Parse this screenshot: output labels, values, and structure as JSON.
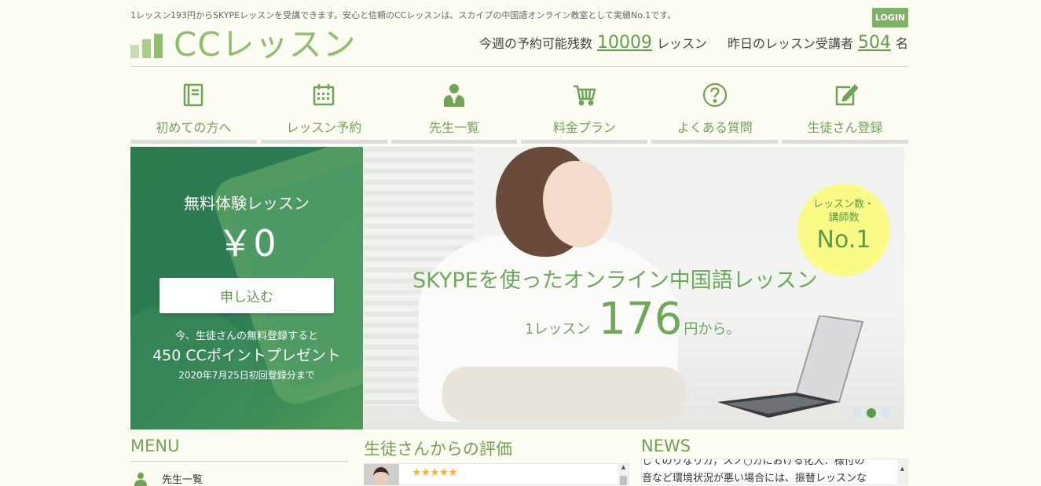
{
  "header": {
    "tagline": "1レッスン193円からSKYPEレッスンを受講できます。安心と信頼のCCレッスンは、スカイプの中国語オンライン教室として実績No.1です。",
    "login_label": "LOGIN",
    "logo_text": "CCレッスン",
    "stats": {
      "weekly_label": "今週の予約可能残数",
      "weekly_value": "10009",
      "weekly_unit": "レッスン",
      "yesterday_label": "昨日のレッスン受講者",
      "yesterday_value": "504",
      "yesterday_unit": "名"
    }
  },
  "nav": {
    "items": [
      {
        "label": "初めての方へ",
        "icon": "book-icon"
      },
      {
        "label": "レッスン予約",
        "icon": "calendar-icon"
      },
      {
        "label": "先生一覧",
        "icon": "teacher-icon"
      },
      {
        "label": "料金プラン",
        "icon": "cart-icon"
      },
      {
        "label": "よくある質問",
        "icon": "question-icon"
      },
      {
        "label": "生徒さん登録",
        "icon": "edit-icon"
      }
    ]
  },
  "promo": {
    "title": "無料体験レッスン",
    "price": "￥0",
    "button_label": "申し込む",
    "line1": "今、生徒さんの無料登録すると",
    "line2": "450 CCポイントプレゼント",
    "line3": "2020年7月25日初回登録分まで"
  },
  "hero": {
    "badge_line1": "レッスン数・",
    "badge_line2": "講師数",
    "badge_big": "No.1",
    "headline": "SKYPEを使ったオンライン中国語レッスン",
    "sub_prefix": "1レッスン",
    "sub_price": "176",
    "sub_suffix": "円から。",
    "slides_total": 3,
    "slide_active": 2
  },
  "menu": {
    "title": "MENU",
    "first_item": "先生一覧"
  },
  "reviews": {
    "title": "生徒さんからの評価",
    "stars": "★★★★★"
  },
  "news": {
    "title": "NEWS",
    "line1": "してのりなりカ，スノ○カにおける化大：様付の",
    "line2": "音など環境状況が悪い場合には、振替レッスンな"
  },
  "colors": {
    "accent": "#6ea454",
    "login_bg": "#7fb167",
    "promo_bg": "#2a7c55",
    "badge_bg": "#fafa86",
    "star": "#f2b630"
  }
}
